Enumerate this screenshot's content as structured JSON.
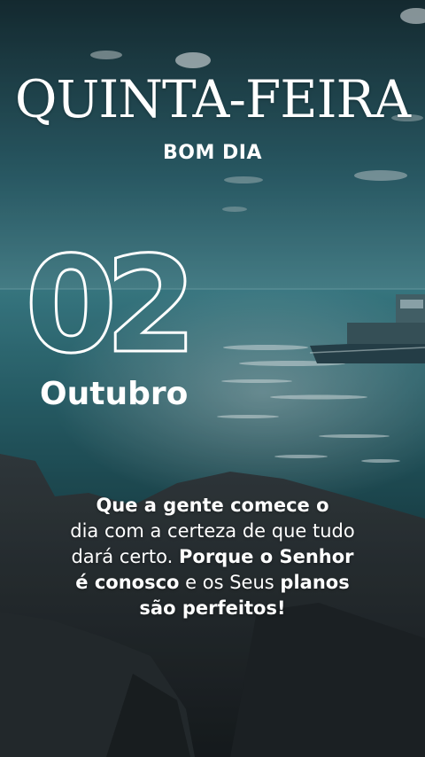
{
  "header": {
    "title": "QUINTA-FEIRA",
    "subtitle": "BOM DIA"
  },
  "date": {
    "day": "02",
    "month": "Outubro"
  },
  "quote": {
    "line1": "Que a gente comece o",
    "line2": "dia com a certeza de que tudo",
    "line3_normal": "dará certo.",
    "line3_bold": "Porque o Senhor",
    "line4_bold1": "é conosco",
    "line4_normal": "e os Seus",
    "line4_bold2": "planos",
    "line5": "são perfeitos!"
  },
  "colors": {
    "sky_top": "#1b3a44",
    "sky_bottom": "#3d7c88",
    "sea": "#2f6e78",
    "rock": "#2a3236",
    "text": "#ffffff"
  }
}
